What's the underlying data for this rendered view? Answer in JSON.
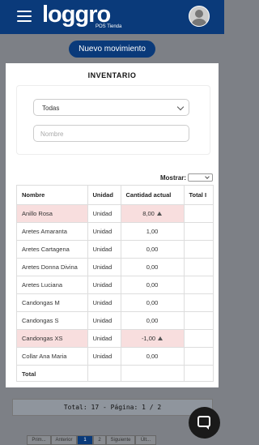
{
  "header": {
    "logo_word": "loggro",
    "logo_sub": "POS Tienda",
    "menu_icon": "hamburger-icon",
    "avatar_icon": "user-avatar-icon"
  },
  "page": {
    "new_button_label": "Nuevo movimiento"
  },
  "modal": {
    "title": "INVENTARIO",
    "filter": {
      "select_value": "Todas",
      "name_placeholder": "Nombre"
    },
    "show_label": "Mostrar:",
    "show_value": "",
    "table": {
      "columns": [
        "Nombre",
        "Unidad",
        "Cantidad actual",
        "Total I"
      ],
      "rows": [
        {
          "name": "Anillo Rosa",
          "unit": "Unidad",
          "qty": "8,00",
          "total": "",
          "highlight": true,
          "trend": "up"
        },
        {
          "name": "Aretes Amaranta",
          "unit": "Unidad",
          "qty": "1,00",
          "total": ""
        },
        {
          "name": "Aretes Cartagena",
          "unit": "Unidad",
          "qty": "0,00",
          "total": ""
        },
        {
          "name": "Aretes Donna Divina",
          "unit": "Unidad",
          "qty": "0,00",
          "total": ""
        },
        {
          "name": "Aretes Luciana",
          "unit": "Unidad",
          "qty": "0,00",
          "total": ""
        },
        {
          "name": "Candongas M",
          "unit": "Unidad",
          "qty": "0,00",
          "total": ""
        },
        {
          "name": "Candongas S",
          "unit": "Unidad",
          "qty": "0,00",
          "total": ""
        },
        {
          "name": "Candongas XS",
          "unit": "Unidad",
          "qty": "-1,00",
          "total": "",
          "highlight": true,
          "trend": "up"
        },
        {
          "name": "Collar Ana Maria",
          "unit": "Unidad",
          "qty": "0,00",
          "total": ""
        }
      ],
      "total_label": "Total"
    }
  },
  "footer": {
    "status_text": "Total: 17 - Página: 1 / 2",
    "pager": [
      "Prim...",
      "Anterior",
      "1",
      "2",
      "Siguiente",
      "Últ..."
    ],
    "active_page": "1",
    "chat_icon": "chat-icon"
  },
  "colors": {
    "brand": "#0a3a7a",
    "highlight_row": "#f8dede",
    "overlay": "#7d8086"
  }
}
